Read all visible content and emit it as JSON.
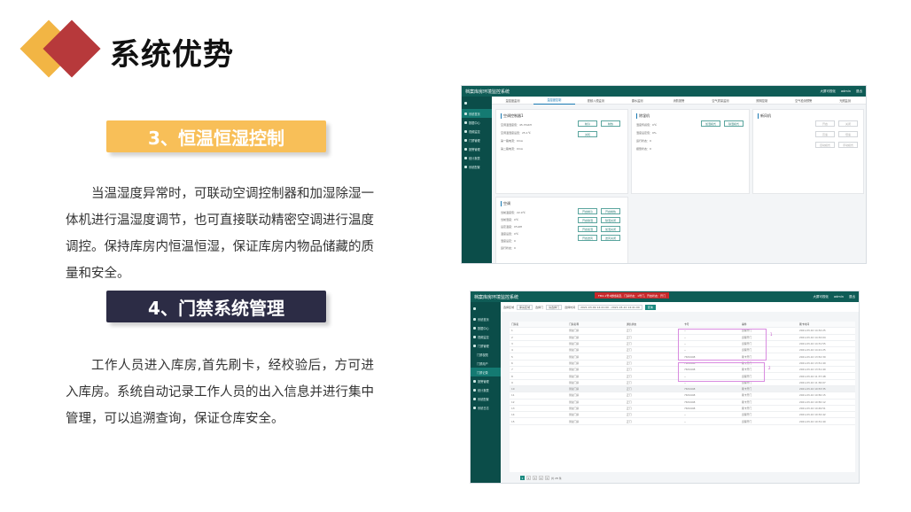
{
  "page": {
    "title": "系统优势",
    "colors": {
      "gold": "#f2b544",
      "red": "#b7393b",
      "navy": "#2c2c45",
      "teal": "#0f5c56"
    }
  },
  "section3": {
    "heading": "3、恒温恒湿控制",
    "body": "当温湿度异常时，可联动空调控制器和加湿除湿一体机进行温湿度调节，也可直接联动精密空调进行温度调控。保持库房内恒温恒湿，保证库房内物品储藏的质量和安全。"
  },
  "section4": {
    "heading": "4、门禁系统管理",
    "body": "工作人员进入库房,首先刷卡，经校验后，方可进入库房。系统自动记录工作人员的出入信息并进行集中管理，可以追溯查询，保证仓库安全。"
  },
  "shot1": {
    "app_title": "档案库房环境监控系统",
    "top_right": [
      "大屏可视化",
      "admin",
      "退出"
    ],
    "tabs": [
      "温湿度监测",
      "温湿度控制",
      "视频入侵监测",
      "漏水监测",
      "消防报警",
      "空气质量监测",
      "照明控制",
      "空气检测预警",
      "光照监测"
    ],
    "active_tab": 1,
    "sidebar": [
      "系统首页",
      "数据中心",
      "视频监控",
      "门禁管理",
      "报警管理",
      "统计报表",
      "系统配置"
    ],
    "panel_ac": {
      "title": "空调控制器1",
      "rows": [
        "空调温湿度值：45.3%RH",
        "空调温湿度设置：25.1℃",
        "第一路电流：0mA",
        "第二路电流：0mA"
      ],
      "buttons": [
        "制冷",
        "制热",
        "关机"
      ]
    },
    "panel_hum": {
      "title": "除湿机",
      "rows": [
        "湿度传感值：0℃",
        "湿度设定值：0%",
        "运行状态：0",
        "报警状态：0"
      ],
      "buttons": [
        "加湿模式",
        "除湿模式"
      ]
    },
    "panel_fresh": {
      "title": "新风机",
      "buttons": [
        "开启",
        "关闭",
        "高速",
        "低速",
        "自动模式",
        "手动模式"
      ]
    },
    "panel_precise": {
      "title": "空调",
      "rows": [
        "当前温度值：22.9℃",
        "当前湿度：0℃",
        "设定温度：0%RH",
        "温度设置：0℃",
        "湿度设定：0",
        "运行状态：0",
        "报警状态：0"
      ],
      "buttons": [
        "开启制冷",
        "开启制热",
        "开启除湿",
        "除湿关闭",
        "开启加湿",
        "加湿关闭",
        "开启送风",
        "送风关闭"
      ]
    }
  },
  "shot2": {
    "app_title": "档案库房环境监控系统",
    "alarm": "FM2-1号1楼档案室，门禁状态：1号门，开启状态：开门",
    "top_right": [
      "大屏可视化",
      "admin",
      "退出"
    ],
    "sidebar": [
      "系统首页",
      "数据中心",
      "视频监控",
      "门禁管理",
      "门禁权限",
      "门禁用户",
      "门禁记录",
      "报警管理",
      "统计报表",
      "系统配置",
      "系统日志"
    ],
    "filter": {
      "label1": "选择区域",
      "value1": "库房区域",
      "label2": "选择门",
      "value2": "请选择门",
      "label3": "选择时间",
      "value3": "2021-03-09 14:41:00 - 2021-03-10 14:41:00",
      "button": "查询"
    },
    "columns": [
      "门禁名",
      "门禁名称",
      "通信状态",
      "卡号",
      "事件",
      "刷卡时间"
    ],
    "rows": [
      [
        "1",
        "测试门禁",
        "正门",
        "--",
        "远程开门",
        "2021-03-10 14:32:25"
      ],
      [
        "2",
        "测试门禁",
        "正门",
        "--",
        "远程开门",
        "2021-03-10 14:32:04"
      ],
      [
        "3",
        "测试门禁",
        "正门",
        "--",
        "远程开门",
        "2021-03-10 14:31:55"
      ],
      [
        "4",
        "测试门禁",
        "正门",
        "--",
        "远程开门",
        "2021-03-10 14:21:25"
      ],
      [
        "5",
        "测试门禁",
        "正门",
        "7634448",
        "刷卡开门",
        "2021-03-10 13:52:30"
      ],
      [
        "6",
        "测试门禁",
        "正门",
        "7634448",
        "刷卡开门",
        "2021-03-10 13:51:40"
      ],
      [
        "7",
        "测试门禁",
        "正门",
        "7634448",
        "刷卡开门",
        "2021-03-10 13:51:40"
      ],
      [
        "8",
        "测试门禁",
        "正门",
        "--",
        "远程开门",
        "2021-03-10 11:37:48"
      ],
      [
        "9",
        "测试门禁",
        "正门",
        "--",
        "远程开门",
        "2021-03-10 11:36:07"
      ],
      [
        "10",
        "测试门禁",
        "正门",
        "7634448",
        "刷卡开门",
        "2021-03-10 10:53:35"
      ],
      [
        "11",
        "测试门禁",
        "正门",
        "7634448",
        "刷卡开门",
        "2021-03-10 10:50:15"
      ],
      [
        "12",
        "测试门禁",
        "正门",
        "7634448",
        "刷卡开门",
        "2021-03-10 10:50:12"
      ],
      [
        "13",
        "测试门禁",
        "正门",
        "7634448",
        "刷卡开门",
        "2021-03-10 10:49:51"
      ],
      [
        "14",
        "测试门禁",
        "正门",
        "--",
        "远程开门",
        "2021-03-10 10:32:42"
      ],
      [
        "15",
        "测试门禁",
        "正门",
        "--",
        "远程开门",
        "2021-03-10 10:31:40"
      ]
    ],
    "annotations": [
      "1",
      "2"
    ],
    "pager": {
      "pages": [
        "1",
        "2",
        "3",
        "4",
        "5"
      ],
      "suffix": "共 28 条"
    }
  }
}
